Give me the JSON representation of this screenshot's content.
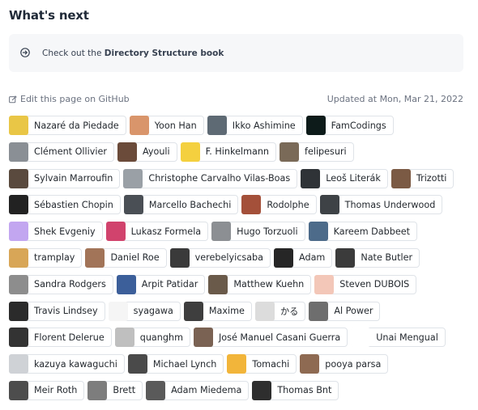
{
  "heading": "What's next",
  "next": {
    "prefix": "Check out the ",
    "link": "Directory Structure book",
    "icon": "arrow-circle-right-icon"
  },
  "edit_link": "Edit this page on GitHub",
  "updated": "Updated at Mon, Mar 21, 2022",
  "contributor_rows": [
    [
      {
        "name": "Nazaré da Piedade",
        "color": "#e9c646"
      },
      {
        "name": "Yoon Han",
        "color": "#d9956b"
      },
      {
        "name": "Ikko Ashimine",
        "color": "#5e6a74"
      },
      {
        "name": "FamCodings",
        "color": "#0d1b1a"
      }
    ],
    [
      {
        "name": "Clément Ollivier",
        "color": "#8a8f95"
      },
      {
        "name": "Ayouli",
        "color": "#6b4b3a"
      },
      {
        "name": "F. Hinkelmann",
        "color": "#f4d03f"
      },
      {
        "name": "felipesuri",
        "color": "#7a6a58"
      }
    ],
    [
      {
        "name": "Sylvain Marroufin",
        "color": "#5a4a3e"
      },
      {
        "name": "Christophe Carvalho Vilas-Boas",
        "color": "#9aa0a6"
      },
      {
        "name": "Leoš Literák",
        "color": "#2f3337"
      },
      {
        "name": "Trizotti",
        "color": "#7b5a44"
      }
    ],
    [
      {
        "name": "Sébastien Chopin",
        "color": "#222222"
      },
      {
        "name": "Marcello Bachechi",
        "color": "#4a4f55"
      },
      {
        "name": "Rodolphe",
        "color": "#a4503a"
      },
      {
        "name": "Thomas Underwood",
        "color": "#3e4246"
      }
    ],
    [
      {
        "name": "Shek Evgeniy",
        "color": "#c2a6f0"
      },
      {
        "name": "Lukasz Formela",
        "color": "#d1436d"
      },
      {
        "name": "Hugo Torzuoli",
        "color": "#8c8f93"
      },
      {
        "name": "Kareem Dabbeet",
        "color": "#4d6b8a"
      }
    ],
    [
      {
        "name": "tramplay",
        "color": "#d8a657"
      },
      {
        "name": "Daniel Roe",
        "color": "#a27458"
      },
      {
        "name": "verebelyicsaba",
        "color": "#3a3a3a"
      },
      {
        "name": "Adam",
        "color": "#262626"
      },
      {
        "name": "Nate Butler",
        "color": "#3b3b3b"
      }
    ],
    [
      {
        "name": "Sandra Rodgers",
        "color": "#8d8d8d"
      },
      {
        "name": "Arpit Patidar",
        "color": "#3c5f9a"
      },
      {
        "name": "Matthew Kuehn",
        "color": "#6a5a4a"
      },
      {
        "name": "Steven DUBOIS",
        "color": "#f3c7b8"
      }
    ],
    [
      {
        "name": "Travis Lindsey",
        "color": "#2b2b2b"
      },
      {
        "name": "syagawa",
        "color": "#f5f5f5"
      },
      {
        "name": "Maxime",
        "color": "#3e3e3e"
      },
      {
        "name": "かる",
        "color": "#dcdcdc"
      },
      {
        "name": "Al Power",
        "color": "#6e6e6e"
      }
    ],
    [
      {
        "name": "Florent Delerue",
        "color": "#333333"
      },
      {
        "name": "quanghm",
        "color": "#bfbfbf"
      },
      {
        "name": "José Manuel Casani Guerra",
        "color": "#7a6253"
      },
      {
        "name": "Unai Mengual",
        "color": "#ffffff"
      }
    ],
    [
      {
        "name": "kazuya kawaguchi",
        "color": "#cfd2d6"
      },
      {
        "name": "Michael Lynch",
        "color": "#4a4a4a"
      },
      {
        "name": "Tomachi",
        "color": "#f2b53a"
      },
      {
        "name": "pooya parsa",
        "color": "#8e6a52"
      }
    ],
    [
      {
        "name": "Meir Roth",
        "color": "#4d4d4d"
      },
      {
        "name": "Brett",
        "color": "#7d7d7d"
      },
      {
        "name": "Adam Miedema",
        "color": "#5a5a5a"
      },
      {
        "name": "Thomas Bnt",
        "color": "#2e2e2e"
      }
    ]
  ]
}
